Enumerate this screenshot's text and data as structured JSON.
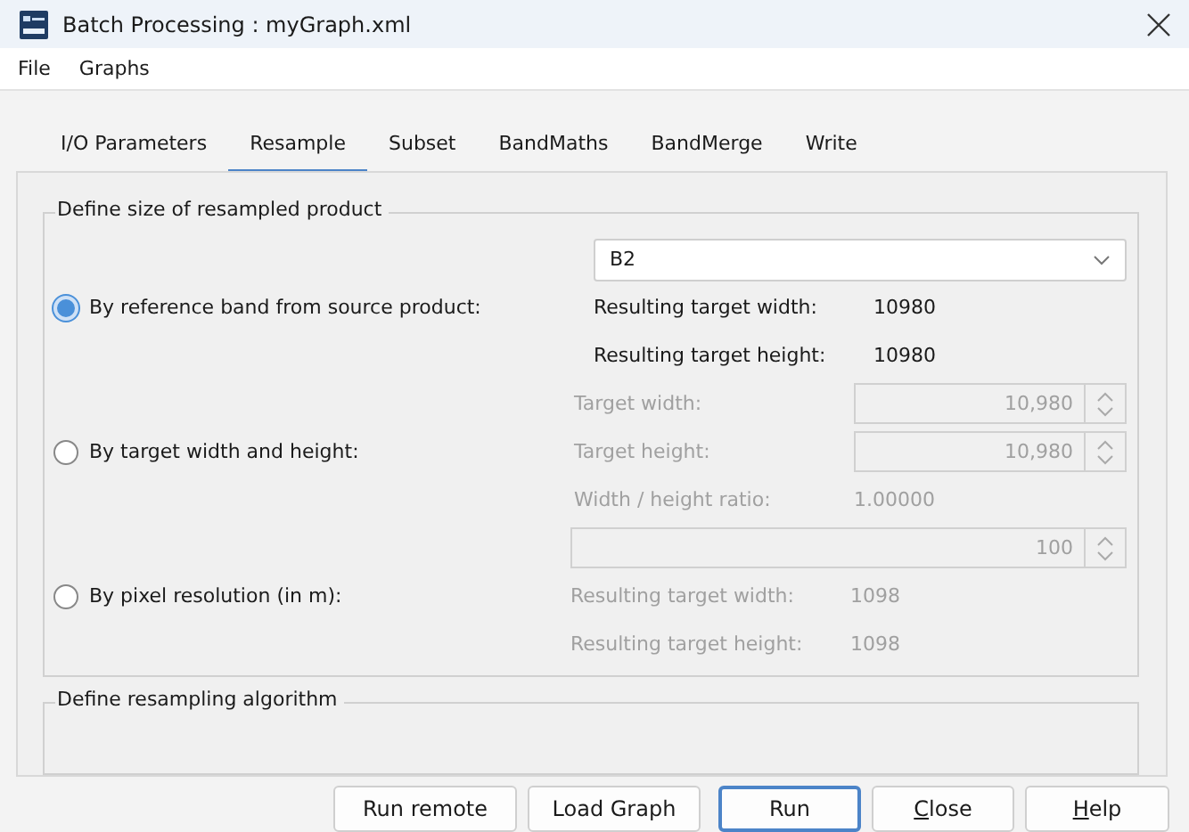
{
  "window": {
    "title": "Batch Processing : myGraph.xml"
  },
  "menu": [
    "File",
    "Graphs"
  ],
  "tabs": [
    {
      "label": "I/O Parameters",
      "selected": false
    },
    {
      "label": "Resample",
      "selected": true
    },
    {
      "label": "Subset",
      "selected": false
    },
    {
      "label": "BandMaths",
      "selected": false
    },
    {
      "label": "BandMerge",
      "selected": false
    },
    {
      "label": "Write",
      "selected": false
    }
  ],
  "size_group": {
    "title": "Define size of resampled product",
    "options": [
      {
        "label": "By reference band from source product:",
        "selected": true,
        "fields": [
          {
            "kind": "dropdown",
            "value": "B2"
          },
          {
            "kind": "readout",
            "label": "Resulting target width:",
            "value": "10980"
          },
          {
            "kind": "readout",
            "label": "Resulting target height:",
            "value": "10980"
          }
        ]
      },
      {
        "label": "By target width and height:",
        "selected": false,
        "fields": [
          {
            "kind": "spinner",
            "label": "Target width:",
            "value": "10,980"
          },
          {
            "kind": "spinner",
            "label": "Target height:",
            "value": "10,980"
          },
          {
            "kind": "readout",
            "label": "Width / height ratio:",
            "value": "1.00000"
          }
        ]
      },
      {
        "label": "By pixel resolution (in m):",
        "selected": false,
        "fields": [
          {
            "kind": "spinner",
            "value": "100"
          },
          {
            "kind": "readout",
            "label": "Resulting target width:",
            "value": "1098"
          },
          {
            "kind": "readout",
            "label": "Resulting target height:",
            "value": "1098"
          }
        ]
      }
    ]
  },
  "algorithm_group": {
    "title": "Define resampling algorithm"
  },
  "buttons": [
    {
      "label": "Run remote",
      "mnemonic": false,
      "default": false
    },
    {
      "label": "Load Graph",
      "mnemonic": false,
      "default": false
    },
    {
      "label": "Run",
      "mnemonic": false,
      "default": true
    },
    {
      "label": "Close",
      "mnemonic": true,
      "default": false
    },
    {
      "label": "Help",
      "mnemonic": true,
      "default": false
    }
  ]
}
